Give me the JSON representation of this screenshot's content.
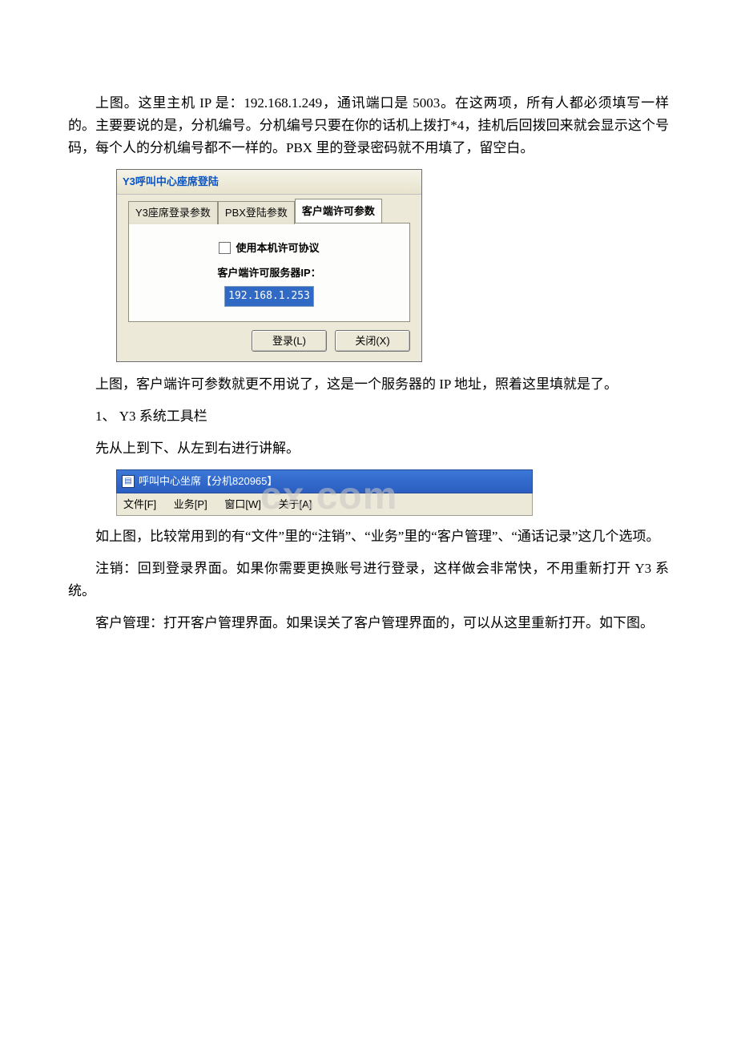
{
  "para": {
    "p1": "上图。这里主机 IP 是：192.168.1.249，通讯端口是 5003。在这两项，所有人都必须填写一样的。主要要说的是，分机编号。分机编号只要在你的话机上拨打*4，挂机后回拨回来就会显示这个号码，每个人的分机编号都不一样的。PBX 里的登录密码就不用填了，留空白。",
    "p2": "上图，客户端许可参数就更不用说了，这是一个服务器的 IP 地址，照着这里填就是了。",
    "p3": "1、 Y3 系统工具栏",
    "p4": "先从上到下、从左到右进行讲解。",
    "p5": "如上图，比较常用到的有“文件”里的“注销”、“业务”里的“客户管理”、“通话记录”这几个选项。",
    "p6": "注销：回到登录界面。如果你需要更换账号进行登录，这样做会非常快，不用重新打开 Y3 系统。",
    "p7": "客户管理：打开客户管理界面。如果误关了客户管理界面的，可以从这里重新打开。如下图。"
  },
  "dialog1": {
    "title": "Y3呼叫中心座席登陆",
    "tabs": {
      "t1": "Y3座席登录参数",
      "t2": "PBX登陆参数",
      "t3": "客户端许可参数"
    },
    "checkbox_label": "使用本机许可协议",
    "ip_label": "客户端许可服务器IP：",
    "ip_value": "192.168.1.253",
    "btn_login": "登录(L)",
    "btn_close": "关闭(X)"
  },
  "menubar": {
    "title": "呼叫中心坐席【分机820965】",
    "items": {
      "file": "文件[F]",
      "biz": "业务[P]",
      "win": "窗口[W]",
      "about": "关于[A]"
    }
  },
  "watermark_left": "",
  "watermark_right": "cx.com"
}
